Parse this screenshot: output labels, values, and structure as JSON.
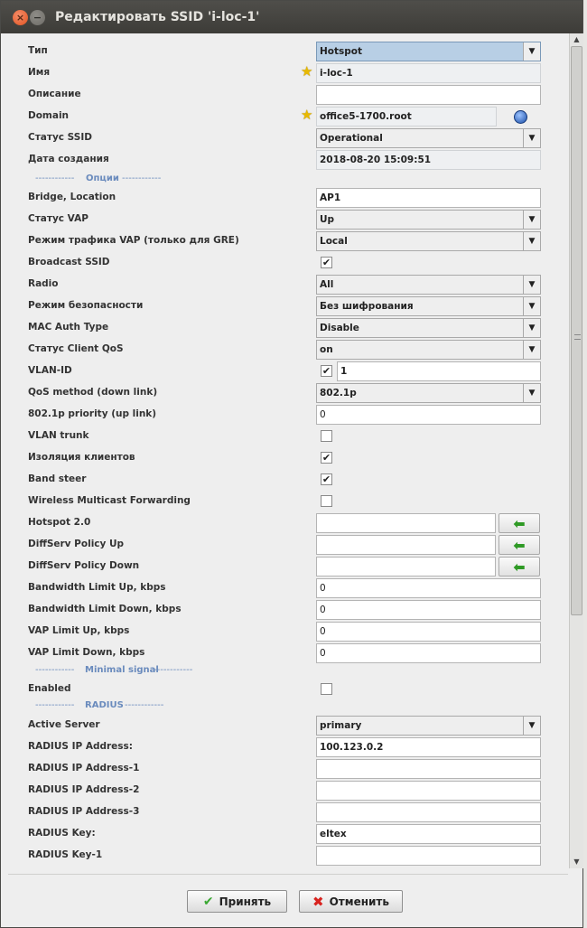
{
  "window": {
    "title": "Редактировать SSID 'i-loc-1'",
    "close_glyph": "×",
    "minimize_glyph": "−"
  },
  "fields": [
    {
      "label": "Тип",
      "type": "combo",
      "value": "Hotspot",
      "highlight": true
    },
    {
      "label": "Имя",
      "type": "text-ro",
      "value": "i-loc-1",
      "star": true
    },
    {
      "label": "Описание",
      "type": "text",
      "value": ""
    },
    {
      "label": "Domain",
      "type": "text-ro",
      "value": "office5-1700.root",
      "star": true,
      "globe": true
    },
    {
      "label": "Статус SSID",
      "type": "combo",
      "value": "Operational"
    },
    {
      "label": "Дата создания",
      "type": "text-ro",
      "value": "2018-08-20 15:09:51"
    }
  ],
  "sections": {
    "options": "Опции",
    "minimal_signal": "Minimal signal",
    "radius": "RADIUS",
    "dashes": "------------"
  },
  "options": [
    {
      "label": "Bridge, Location",
      "type": "text",
      "value": "AP1"
    },
    {
      "label": "Статус VAP",
      "type": "combo",
      "value": "Up"
    },
    {
      "label": "Режим трафика VAP (только для GRE)",
      "type": "combo",
      "value": "Local"
    },
    {
      "label": "Broadcast SSID",
      "type": "checkbox",
      "checked": true
    },
    {
      "label": "Radio",
      "type": "combo",
      "value": "All"
    },
    {
      "label": "Режим безопасности",
      "type": "combo",
      "value": "Без шифрования"
    },
    {
      "label": "MAC Auth Type",
      "type": "combo",
      "value": "Disable"
    },
    {
      "label": "Статус Client QoS",
      "type": "combo",
      "value": "on"
    },
    {
      "label": "VLAN-ID",
      "type": "checkbox-text",
      "checked": true,
      "value": "1"
    },
    {
      "label": "QoS method (down link)",
      "type": "combo",
      "value": "802.1p"
    },
    {
      "label": "802.1p priority (up link)",
      "type": "text",
      "value": "0"
    },
    {
      "label": "VLAN trunk",
      "type": "checkbox",
      "checked": false
    },
    {
      "label": "Изоляция клиентов",
      "type": "checkbox",
      "checked": true
    },
    {
      "label": "Band steer",
      "type": "checkbox",
      "checked": true
    },
    {
      "label": "Wireless Multicast Forwarding",
      "type": "checkbox",
      "checked": false
    },
    {
      "label": "Hotspot 2.0",
      "type": "text-arrow",
      "value": ""
    },
    {
      "label": "DiffServ Policy Up",
      "type": "text-arrow",
      "value": ""
    },
    {
      "label": "DiffServ Policy Down",
      "type": "text-arrow",
      "value": ""
    },
    {
      "label": "Bandwidth Limit Up, kbps",
      "type": "text",
      "value": "0"
    },
    {
      "label": "Bandwidth Limit Down, kbps",
      "type": "text",
      "value": "0"
    },
    {
      "label": "VAP Limit Up, kbps",
      "type": "text",
      "value": "0"
    },
    {
      "label": "VAP Limit Down, kbps",
      "type": "text",
      "value": "0"
    }
  ],
  "minimal_signal": [
    {
      "label": "Enabled",
      "type": "checkbox",
      "checked": false
    }
  ],
  "radius": [
    {
      "label": "Active Server",
      "type": "combo",
      "value": "primary"
    },
    {
      "label": "RADIUS IP Address:",
      "type": "text",
      "value": "100.123.0.2"
    },
    {
      "label": "RADIUS IP Address-1",
      "type": "text",
      "value": ""
    },
    {
      "label": "RADIUS IP Address-2",
      "type": "text",
      "value": ""
    },
    {
      "label": "RADIUS IP Address-3",
      "type": "text",
      "value": ""
    },
    {
      "label": "RADIUS Key:",
      "type": "text",
      "value": "eltex"
    },
    {
      "label": "RADIUS Key-1",
      "type": "text",
      "value": ""
    }
  ],
  "buttons": {
    "ok": "Принять",
    "cancel": "Отменить"
  },
  "glyphs": {
    "check": "✔",
    "arrow_down": "▼",
    "arrow_up": "▲",
    "left_arrow": "⬅",
    "star": "★",
    "ok": "✔",
    "cancel": "✖"
  },
  "colors": {
    "section": "#6a8bbd",
    "highlight_combo": "#b8cfe5",
    "ok_icon": "#3aa832",
    "cancel_icon": "#d8231f"
  }
}
